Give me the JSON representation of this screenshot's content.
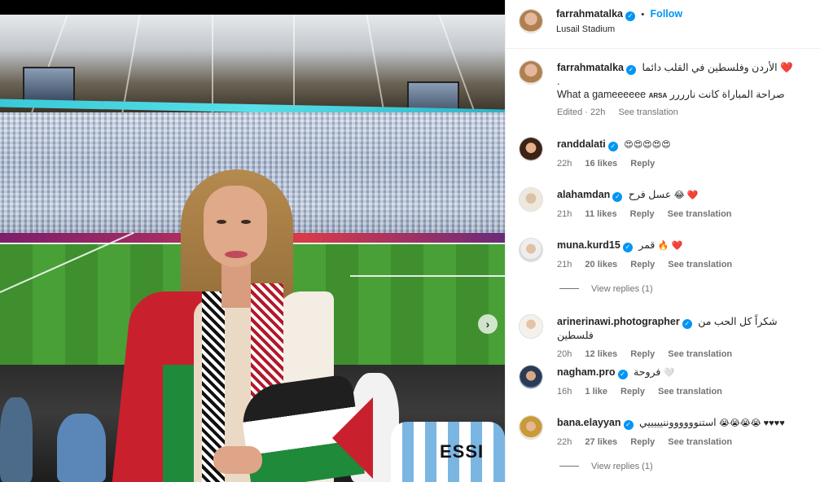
{
  "post": {
    "author": "farrahmatalka",
    "follow_label": "Follow",
    "separator": "•",
    "location": "Lusail Stadium",
    "caption": {
      "line1": "الأردن وفلسطين في القلب دائما",
      "line1_emoji": "❤️",
      "line2": ".",
      "line3": "What a gameeeeee",
      "line3_mark": "ARSA",
      "line3_arabic": "صراحة المباراة كانت نارررر",
      "edited": "Edited",
      "time": "22h",
      "see_translation": "See translation"
    }
  },
  "comments": [
    {
      "user": "randdalati",
      "verified": true,
      "text": "",
      "emoji": "😍😍😍😍😍",
      "time": "22h",
      "likes": "16 likes",
      "reply": "Reply",
      "see_translation": ""
    },
    {
      "user": "alahamdan",
      "verified": true,
      "text": "عسل فرح",
      "emoji": "😂 ❤️",
      "time": "21h",
      "likes": "11 likes",
      "reply": "Reply",
      "see_translation": "See translation"
    },
    {
      "user": "muna.kurd15",
      "verified": true,
      "text": "قمر",
      "emoji": "🔥 ❤️",
      "time": "21h",
      "likes": "20 likes",
      "reply": "Reply",
      "see_translation": "See translation",
      "view_replies": "View replies (1)"
    },
    {
      "user": "arinerinawi.photographer",
      "verified": true,
      "text": "شكراً كل الحب من فلسطين",
      "emoji": "",
      "time": "20h",
      "likes": "12 likes",
      "reply": "Reply",
      "see_translation": "See translation"
    },
    {
      "user": "nagham.pro",
      "verified": true,
      "text": "فروحة",
      "emoji": "🤍",
      "time": "16h",
      "likes": "1 like",
      "reply": "Reply",
      "see_translation": "See translation"
    },
    {
      "user": "bana.elayyan",
      "verified": true,
      "text": "استنووووووننيييييي",
      "emoji": "😭😭😭😭 ♥♥♥♥",
      "time": "22h",
      "likes": "27 likes",
      "reply": "Reply",
      "see_translation": "See translation",
      "view_replies": "View replies (1)"
    }
  ],
  "photo": {
    "jersey_text": "ESSI",
    "carousel_next": "›"
  },
  "colors": {
    "accent": "#0095f6",
    "heart": "#ed4956",
    "secondary_text": "#737373"
  }
}
